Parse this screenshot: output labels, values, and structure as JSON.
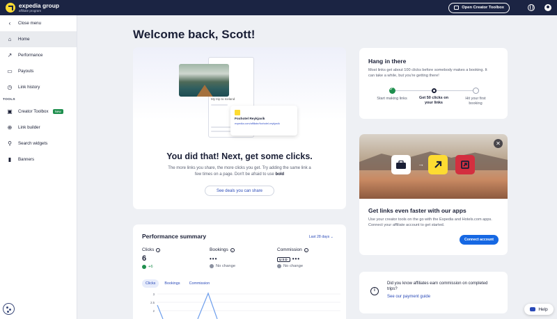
{
  "topbar": {
    "logo_line1": "expedia group",
    "logo_line2": "affiliate program",
    "toolbox_button": "Open Creator Toolbox"
  },
  "sidebar": {
    "close_menu": "Close menu",
    "items": [
      {
        "label": "Home",
        "icon": "home-icon"
      },
      {
        "label": "Performance",
        "icon": "trend-icon"
      },
      {
        "label": "Payouts",
        "icon": "wallet-icon"
      },
      {
        "label": "Link history",
        "icon": "history-icon"
      }
    ],
    "tools_heading": "TOOLS",
    "tools": [
      {
        "label": "Creator Toolbox",
        "icon": "toolbox-icon",
        "badge": "New"
      },
      {
        "label": "Link builder",
        "icon": "plus-circle-icon"
      },
      {
        "label": "Search widgets",
        "icon": "search-icon"
      },
      {
        "label": "Banners",
        "icon": "banner-icon"
      }
    ]
  },
  "main": {
    "welcome": "Welcome back, Scott!",
    "hero": {
      "trip_label": "My trip to Iceland",
      "link_title": "Foxhotel Reykjavik",
      "link_url": "expedia.com/affiliate/foxhotel-reykjavik",
      "title": "You did that! Next, get some clicks.",
      "body": "The more links you share, the more clicks you get. Try adding the same link a few times on a page. Don't be afraid to use",
      "body_bold": "bold",
      "button": "See deals you can share"
    },
    "hang": {
      "title": "Hang in there",
      "body": "Most links get about 100 clicks before somebody makes a booking. It can take a while, but you're getting there!",
      "steps": [
        "Start making links",
        "Get 50 clicks on your links",
        "Hit your first booking"
      ]
    },
    "apps": {
      "title": "Get links even faster with our apps",
      "body": "Use your creator tools on the go with the Expedia and Hotels.com apps. Connect your affiliate account to get started.",
      "button": "Connect account"
    },
    "performance": {
      "title": "Performance summary",
      "range": "Last 28 days",
      "clicks_label": "Clicks",
      "clicks_value": "6",
      "clicks_change": "+6",
      "bookings_label": "Bookings",
      "bookings_value": "•••",
      "bookings_change": "No change",
      "commission_label": "Commission",
      "commission_currency": "USD",
      "commission_value": "•••",
      "commission_change": "No change",
      "tabs": [
        "Clicks",
        "Bookings",
        "Commission"
      ],
      "y_ticks": [
        "3",
        "2.5",
        "2"
      ]
    },
    "did_you_know": {
      "text": "Did you know affiliates earn commission on completed trips?",
      "link": "See our payment guide"
    },
    "help": "Help"
  }
}
